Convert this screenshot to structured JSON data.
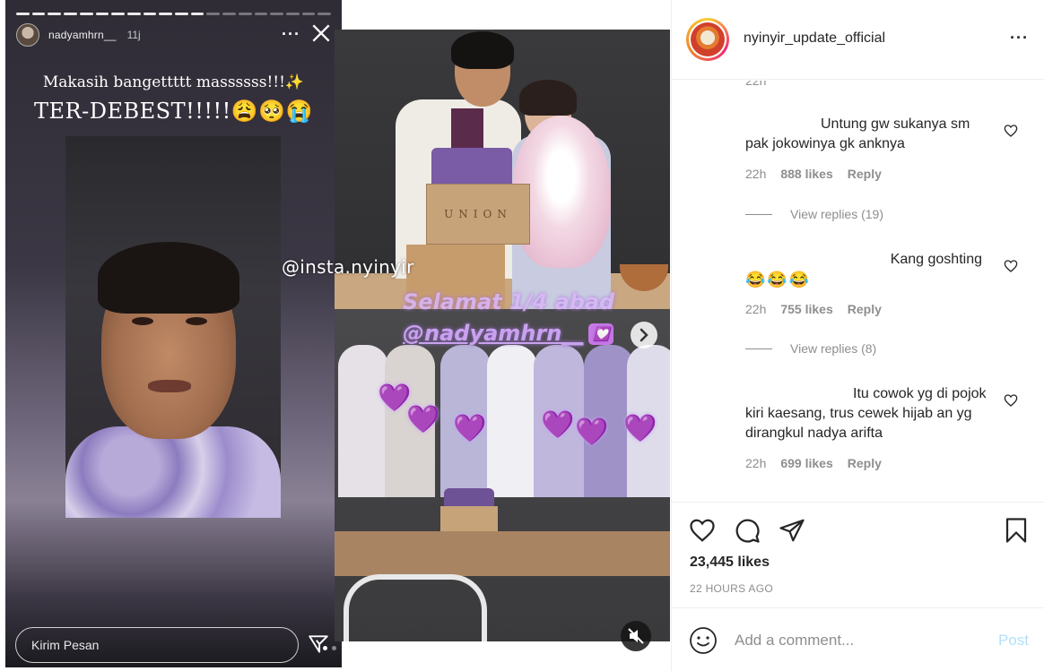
{
  "story": {
    "username": "nadyamhrn__",
    "time": "11j",
    "caption_line1": "Makasih bangettttt massssss!!!✨",
    "caption_line2": "TER-DEBEST!!!!!😩🥺😭",
    "reply_placeholder": "Kirim Pesan"
  },
  "party": {
    "watermark": "@insta.nyinyir",
    "text_line1": "Selamat 1/4 abad",
    "text_line2": "@nadyamhrn__",
    "heart_emoji": "💟",
    "box_label": "UNION",
    "emoji_heart": "💜"
  },
  "post": {
    "account": "nyinyir_update_official",
    "likes": "23,445 likes",
    "time_ago": "22 HOURS AGO",
    "cut_time": "22h",
    "add_comment_placeholder": "Add a comment...",
    "post_label": "Post"
  },
  "comments": [
    {
      "text": "Untung gw sukanya sm pak jokowinya gk anknya",
      "time": "22h",
      "likes": "888 likes",
      "reply": "Reply",
      "view_replies": "View replies (19)"
    },
    {
      "text": "Kang goshting",
      "emoji": "😂😂😂",
      "time": "22h",
      "likes": "755 likes",
      "reply": "Reply",
      "view_replies": "View replies (8)"
    },
    {
      "text": "Itu cowok yg di pojok kiri kaesang, trus cewek hijab an yg dirangkul nadya arifta",
      "time": "22h",
      "likes": "699 likes",
      "reply": "Reply"
    }
  ],
  "icons": {
    "like": "heart-icon",
    "comment": "comment-icon",
    "share": "share-icon",
    "save": "bookmark-icon",
    "more": "more-icon",
    "emoji": "smile-icon"
  },
  "colors": {
    "post_button": "#b2dffc",
    "meta_gray": "#8e8e8e",
    "text": "#262626"
  }
}
